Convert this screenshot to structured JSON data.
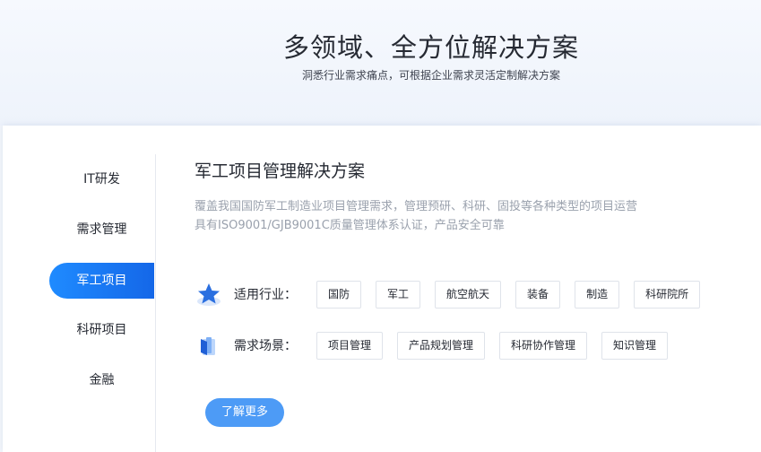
{
  "hero": {
    "title": "多领域、全方位解决方案",
    "subtitle": "洞悉行业需求痛点，可根据企业需求灵活定制解决方案"
  },
  "sidebar": {
    "items": [
      {
        "label": "IT研发",
        "active": false
      },
      {
        "label": "需求管理",
        "active": false
      },
      {
        "label": "军工项目",
        "active": true
      },
      {
        "label": "科研项目",
        "active": false
      },
      {
        "label": "金融",
        "active": false
      }
    ]
  },
  "solution": {
    "title": "军工项目管理解决方案",
    "description_line1": "覆盖我国国防军工制造业项目管理需求，管理预研、科研、固投等各种类型的项目运营",
    "description_line2": "具有ISO9001/GJB9001C质量管理体系认证，产品安全可靠",
    "industries": {
      "icon": "star-icon",
      "label": "适用行业：",
      "tags": [
        "国防",
        "军工",
        "航空航天",
        "装备",
        "制造",
        "科研院所"
      ]
    },
    "scenarios": {
      "icon": "book-icon",
      "label": "需求场景：",
      "tags": [
        "项目管理",
        "产品规划管理",
        "科研协作管理",
        "知识管理"
      ]
    },
    "more_button": "了解更多"
  },
  "colors": {
    "accent": "#1467e8",
    "button": "#4d9bf6",
    "text": "#262a33",
    "muted": "#9aa1ad"
  }
}
